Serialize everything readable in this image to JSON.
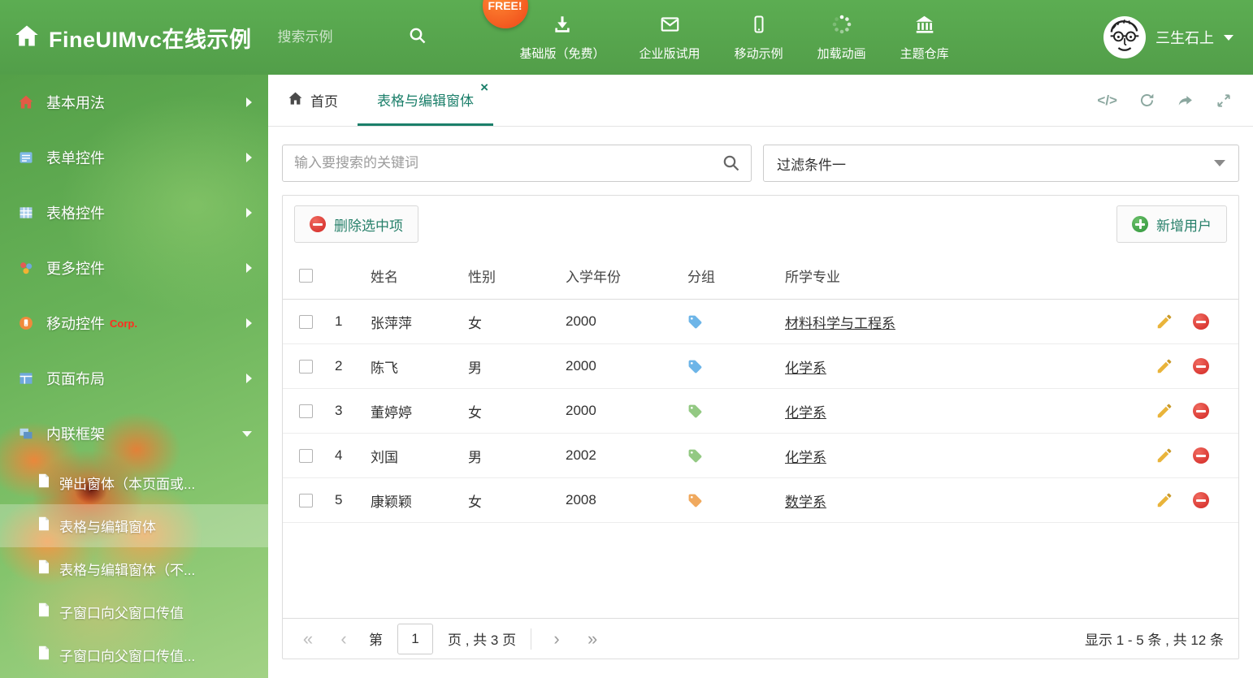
{
  "header": {
    "title": "FineUIMvc在线示例",
    "search_placeholder": "搜索示例",
    "free_badge": "FREE!",
    "nav_items": [
      {
        "label": "基础版（免费）",
        "icon": "download-icon"
      },
      {
        "label": "企业版试用",
        "icon": "envelope-icon"
      },
      {
        "label": "移动示例",
        "icon": "mobile-icon"
      },
      {
        "label": "加载动画",
        "icon": "spinner-icon"
      },
      {
        "label": "主题仓库",
        "icon": "bank-icon"
      }
    ],
    "user_name": "三生石上"
  },
  "sidebar": {
    "items": [
      {
        "label": "基本用法",
        "icon": "home-icon"
      },
      {
        "label": "表单控件",
        "icon": "form-icon"
      },
      {
        "label": "表格控件",
        "icon": "table-icon"
      },
      {
        "label": "更多控件",
        "icon": "more-icon"
      },
      {
        "label": "移动控件",
        "badge": "Corp.",
        "icon": "mobile-icon"
      },
      {
        "label": "页面布局",
        "icon": "layout-icon"
      },
      {
        "label": "内联框架",
        "icon": "frame-icon"
      }
    ],
    "subitems": [
      {
        "label": "弹出窗体（本页面或..."
      },
      {
        "label": "表格与编辑窗体"
      },
      {
        "label": "表格与编辑窗体（不..."
      },
      {
        "label": "子窗口向父窗口传值"
      },
      {
        "label": "子窗口向父窗口传值..."
      }
    ]
  },
  "tabs": {
    "home_label": "首页",
    "active_label": "表格与编辑窗体",
    "close_icon": "×",
    "code_icon": "</>"
  },
  "filters": {
    "search_placeholder": "输入要搜索的关键词",
    "filter_selected": "过滤条件一"
  },
  "toolbar": {
    "delete_label": "删除选中项",
    "add_label": "新增用户"
  },
  "table": {
    "columns": [
      "姓名",
      "性别",
      "入学年份",
      "分组",
      "所学专业"
    ],
    "rows": [
      {
        "num": "1",
        "name": "张萍萍",
        "gender": "女",
        "year": "2000",
        "tag_color": "#6db5e8",
        "major": "材料科学与工程系"
      },
      {
        "num": "2",
        "name": "陈飞",
        "gender": "男",
        "year": "2000",
        "tag_color": "#6db5e8",
        "major": "化学系"
      },
      {
        "num": "3",
        "name": "董婷婷",
        "gender": "女",
        "year": "2000",
        "tag_color": "#93c983",
        "major": "化学系"
      },
      {
        "num": "4",
        "name": "刘国",
        "gender": "男",
        "year": "2002",
        "tag_color": "#93c983",
        "major": "化学系"
      },
      {
        "num": "5",
        "name": "康颖颖",
        "gender": "女",
        "year": "2008",
        "tag_color": "#f0a95e",
        "major": "数学系"
      }
    ]
  },
  "pagination": {
    "first_icon": "«",
    "prev_icon": "‹",
    "page_prefix": "第",
    "current_page": "1",
    "page_suffix": "页 , 共 3 页",
    "next_icon": "›",
    "last_icon": "»",
    "summary": "显示 1 - 5 条 , 共 12 条"
  },
  "colors": {
    "header_green": "#57a84e",
    "accent_teal": "#1b7f6a",
    "danger_red": "#d93732",
    "success_green": "#3c9f45"
  }
}
